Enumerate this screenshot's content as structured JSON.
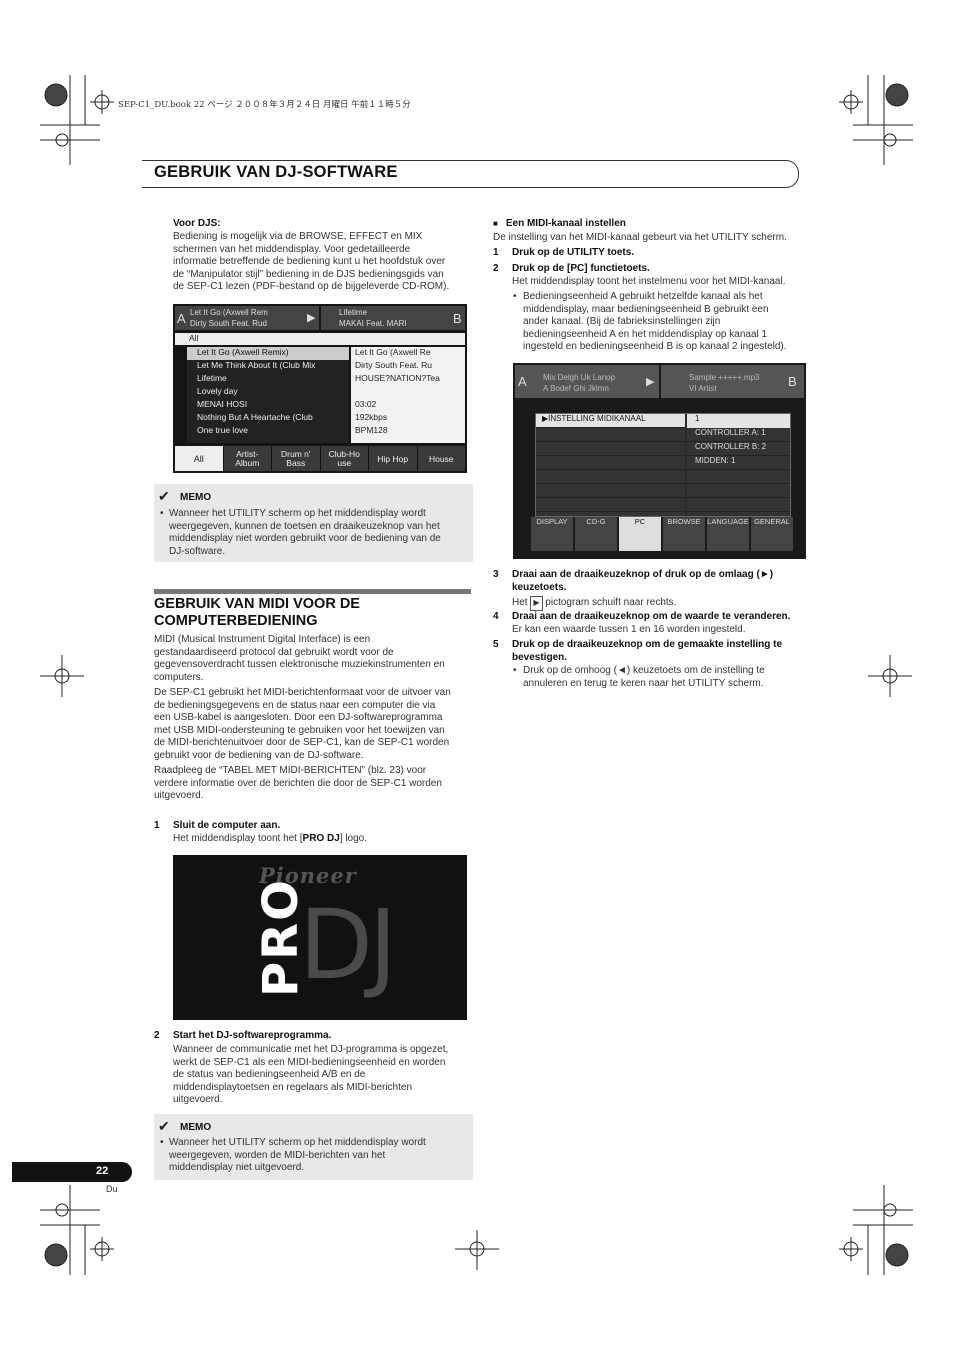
{
  "print_header": "SEP-C1_DU.book  22 ページ  ２００８年３月２４日  月曜日  午前１１時５分",
  "chapter_title": "Gebruik van DJ-software",
  "left": {
    "voor_djs_title": "Voor DJS:",
    "voor_djs_lines": [
      "Bediening is mogelijk via de BROWSE, EFFECT en MIX",
      "schermen van het middendisplay. Voor gedetailleerde",
      "informatie betreffende de bediening kunt u het hoofdstuk over",
      "de “Manipulator stijl” bediening in de DJS bedieningsgids van",
      "de SEP-C1 lezen (PDF-bestand op de bijgeleverde CD-ROM)."
    ],
    "screen1": {
      "deck_a_label": "A",
      "deck_b_label": "B",
      "deck_a_line1": "Let It Go (Axwell Rem",
      "deck_a_line2": "Dirty South Feat. Rud",
      "deck_b_line1": "Lifetime",
      "deck_b_line2": "MAKAI Feat. MARI",
      "list_header": "All",
      "tracks": [
        "Let It Go (Axwell Remix)",
        "Let Me Think About It (Club Mix",
        "Lifetime",
        "Lovely day",
        "MENAI HOSI",
        "Nothing But A Heartache (Club",
        "One true love"
      ],
      "info": [
        "Let It Go (Axwell Re",
        "Dirty South Feat. Ru",
        "HOUSE?NATION?Tea",
        "",
        "03:02",
        "192kbps",
        "BPM128"
      ],
      "tabs": [
        "All",
        "Artist-\nAlbum",
        "Drum n'\nBass",
        "Club-Ho\nuse",
        "Hip Hop",
        "House"
      ]
    },
    "memo1_title": "MEMO",
    "memo1_lines": [
      "Wanneer het UTILITY scherm op het middendisplay wordt",
      "weergegeven, kunnen de toetsen en draaikeuzeknop van het",
      "middendisplay niet worden gebruikt voor de bediening van de",
      "DJ-software."
    ],
    "section_title_1": "Gebruik van MIDI voor de",
    "section_title_2": "computerbediening",
    "para1": [
      "MIDI (Musical Instrument Digital Interface) is een",
      "gestandaardiseerd protocol dat gebruikt wordt voor de",
      "gegevensoverdracht tussen elektronische muziekinstrumenten en",
      "computers."
    ],
    "para2": [
      "De SEP-C1 gebruikt het MIDI-berichtenformaat voor de uitvoer van",
      "de bedieningsgegevens en de status naar een computer die via",
      "een USB-kabel is aangesloten. Door een DJ-softwareprogramma",
      "met USB MIDI-ondersteuning te gebruiken voor het toewijzen van",
      "de MIDI-berichtenuitvoer door de SEP-C1, kan de SEP-C1 worden",
      "gebruikt voor de bediening van de DJ-software."
    ],
    "para3": [
      "Raadpleeg de “TABEL MET MIDI-BERICHTEN” (blz. 23) voor",
      "verdere informatie over de berichten die door de SEP-C1 worden",
      "uitgevoerd."
    ],
    "step1_num": "1",
    "step1_title": "Sluit de computer aan.",
    "step1_desc_pre": "Het middendisplay toont het [",
    "step1_desc_bold": "PRO DJ",
    "step1_desc_post": "] logo.",
    "logo_brand": "Pioneer",
    "logo_pro": "PRO",
    "logo_dj": "DJ",
    "step2_num": "2",
    "step2_title": "Start het DJ-softwareprogramma.",
    "step2_lines": [
      "Wanneer de communicatie met het DJ-programma is opgezet,",
      "werkt de SEP-C1 als een MIDI-bedieningseenheid en worden",
      "de status van bedieningseenheid A/B en de",
      "middendisplaytoetsen en regelaars als MIDI-berichten",
      "uitgevoerd."
    ],
    "memo2_title": "MEMO",
    "memo2_lines": [
      "Wanneer het UTILITY scherm op het middendisplay wordt",
      "weergegeven, worden de MIDI-berichten van het",
      "middendisplay niet uitgevoerd."
    ]
  },
  "right": {
    "midi_title": "Een MIDI-kanaal instellen",
    "midi_intro": "De instelling van het MIDI-kanaal gebeurt via het UTILITY scherm.",
    "step1": "Druk op de UTILITY toets.",
    "step2": "Druk op de [PC] functietoets.",
    "step2_desc": "Het middendisplay toont het instelmenu voor het MIDI-kanaal.",
    "step2_bullet": [
      "Bedieningseenheid A gebruikt hetzelfde kanaal als het",
      "middendisplay, maar bedieningseenheid B gebruikt een",
      "ander kanaal. (Bij de fabrieksinstellingen zijn",
      "bedieningseenheid A en het middendisplay op kanaal 1",
      "ingesteld en bedieningseenheid B is op kanaal 2 ingesteld)."
    ],
    "screen2": {
      "deck_a_label": "A",
      "deck_b_label": "B",
      "deck_a_line1": "Mix Delgh Uk Lanop",
      "deck_a_line2": "A Bodef Ghi Jklmn",
      "deck_b_line1": "Sample +++++.mp3",
      "deck_b_line2": "VI Artist",
      "menu_item": "INSTELLING MIDIKANAAL",
      "values": [
        "1",
        "CONTROLLER A: 1",
        "CONTROLLER B: 2",
        "MIDDEN: 1"
      ],
      "tabs": [
        "DISPLAY",
        "CD-G",
        "PC",
        "BROWSE",
        "LANGUAGE",
        "GENERAL"
      ]
    },
    "step3_line1": "Draai aan de draaikeuzeknop of druk op de omlaag (►)",
    "step3_line2": "keuzetoets.",
    "step3_desc_pre": "Het",
    "step3_desc_post": "pictogram schuift naar rechts.",
    "step4": "Draai aan de draaikeuzeknop om de waarde te veranderen.",
    "step4_desc": "Er kan een waarde tussen 1 en 16 worden ingesteld.",
    "step5_line1": "Druk op de draaikeuzeknop om de gemaakte instelling te",
    "step5_line2": "bevestigen.",
    "step5_bullet": [
      "Druk op de omhoog (◄) keuzetoets om de instelling te",
      "annuleren en terug te keren naar het UTILITY scherm."
    ]
  },
  "page_number": "22",
  "language_code": "Du"
}
